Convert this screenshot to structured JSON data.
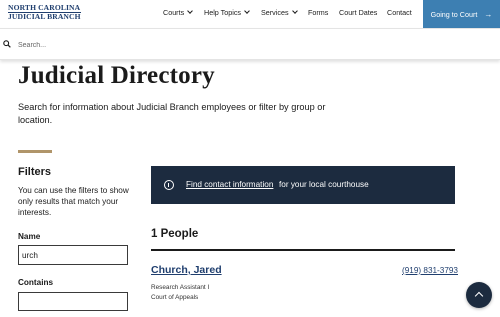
{
  "header": {
    "logo_line1": "NORTH CAROLINA",
    "logo_line2": "JUDICIAL BRANCH",
    "nav": [
      {
        "label": "Courts",
        "has_dropdown": true
      },
      {
        "label": "Help Topics",
        "has_dropdown": true
      },
      {
        "label": "Services",
        "has_dropdown": true
      },
      {
        "label": "Forms",
        "has_dropdown": false
      },
      {
        "label": "Court Dates",
        "has_dropdown": false
      },
      {
        "label": "Contact",
        "has_dropdown": false
      }
    ],
    "cta_label": "Going to Court",
    "cta_icon": "arrow-right-icon",
    "colors": {
      "brand": "#1f3e6e",
      "cta": "#3d7fb2"
    }
  },
  "search": {
    "placeholder": "Search...",
    "value": "",
    "icon": "search-icon"
  },
  "main": {
    "title": "Judicial Directory",
    "intro": "Search for information about Judicial Branch employees or filter by group or location."
  },
  "filters": {
    "heading": "Filters",
    "description": "You can use the filters to show only results that match your interests.",
    "name_label": "Name",
    "name_value": "urch",
    "contains_label": "Contains",
    "contains_value": "",
    "accent_color": "#b0956a"
  },
  "banner": {
    "icon": "info-icon",
    "link_text": "Find contact information",
    "rest_text": "for your local courthouse",
    "background": "#1c2b3f"
  },
  "results": {
    "count_label": "1 People",
    "people": [
      {
        "name": "Church, Jared",
        "phone": "(919) 831-3793",
        "title": "Research Assistant I",
        "unit": "Court of Appeals"
      }
    ]
  },
  "scroll_top": {
    "icon": "chevron-up-icon"
  }
}
